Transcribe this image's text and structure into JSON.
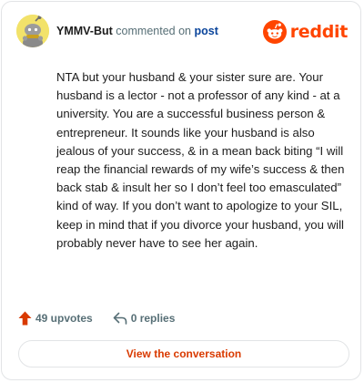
{
  "header": {
    "username": "YMMV-But",
    "commented_on": "commented on",
    "post_link": "post",
    "brand": "reddit"
  },
  "comment": {
    "text": "NTA but your husband & your sister sure are. Your husband is a lector - not a professor of any kind - at a university. You are a successful business person & entrepreneur. It sounds like your husband is also jealous of your success, & in a mean back biting “I will reap the financial rewards of my wife’s success & then back stab & insult her so I don’t feel too emasculated” kind of way. If you don’t want to apologize to your SIL, keep in mind that if you divorce your husband, you will probably never have to see her again."
  },
  "footer": {
    "upvotes": "49 upvotes",
    "replies": "0 replies",
    "view_button": "View the conversation"
  },
  "colors": {
    "brand": "#ff4500",
    "link": "#0a449b",
    "button_text": "#d93a00",
    "muted": "#576f76",
    "avatar_bg": "#f2e26a"
  },
  "icons": {
    "avatar": "snoo-avatar-icon",
    "logo": "reddit-logo-icon",
    "upvote": "upvote-arrow-icon",
    "reply": "reply-arrow-icon"
  }
}
